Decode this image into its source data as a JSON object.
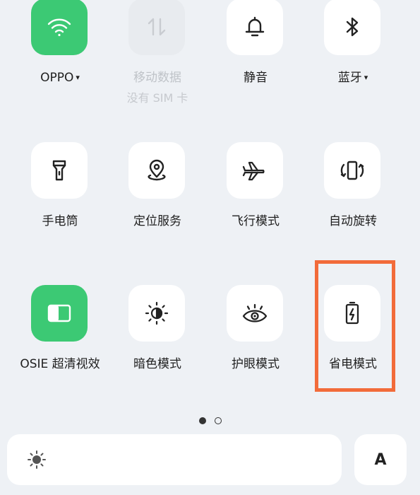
{
  "tiles": [
    {
      "id": "wifi",
      "label": "OPPO",
      "caret": "▾",
      "icon": "wifi-icon",
      "state": "active"
    },
    {
      "id": "mobile-data",
      "label": "移动数据",
      "sublabel": "没有 SIM 卡",
      "icon": "data-arrows-icon",
      "state": "disabled"
    },
    {
      "id": "silent",
      "label": "静音",
      "icon": "bell-icon",
      "state": "off"
    },
    {
      "id": "bluetooth",
      "label": "蓝牙",
      "caret": "▾",
      "icon": "bluetooth-icon",
      "state": "off"
    },
    {
      "id": "flashlight",
      "label": "手电筒",
      "icon": "flashlight-icon",
      "state": "off"
    },
    {
      "id": "location",
      "label": "定位服务",
      "icon": "location-pin-icon",
      "state": "off"
    },
    {
      "id": "airplane",
      "label": "飞行模式",
      "icon": "airplane-icon",
      "state": "off"
    },
    {
      "id": "auto-rotate",
      "label": "自动旋转",
      "icon": "auto-rotate-icon",
      "state": "off"
    },
    {
      "id": "osie",
      "label": "OSIE 超清视效",
      "icon": "osie-icon",
      "state": "active"
    },
    {
      "id": "dark-mode",
      "label": "暗色模式",
      "icon": "dark-mode-icon",
      "state": "off"
    },
    {
      "id": "eye-care",
      "label": "护眼模式",
      "icon": "eye-icon",
      "state": "off"
    },
    {
      "id": "power-saving",
      "label": "省电模式",
      "icon": "battery-bolt-icon",
      "state": "off"
    }
  ],
  "pager": {
    "count": 2,
    "active_index": 0
  },
  "brightness": {
    "icon": "sun-icon"
  },
  "auto_brightness": {
    "label": "A"
  },
  "colors": {
    "active": "#3cc974",
    "highlight": "#f26b3a",
    "background": "#eef1f5"
  }
}
